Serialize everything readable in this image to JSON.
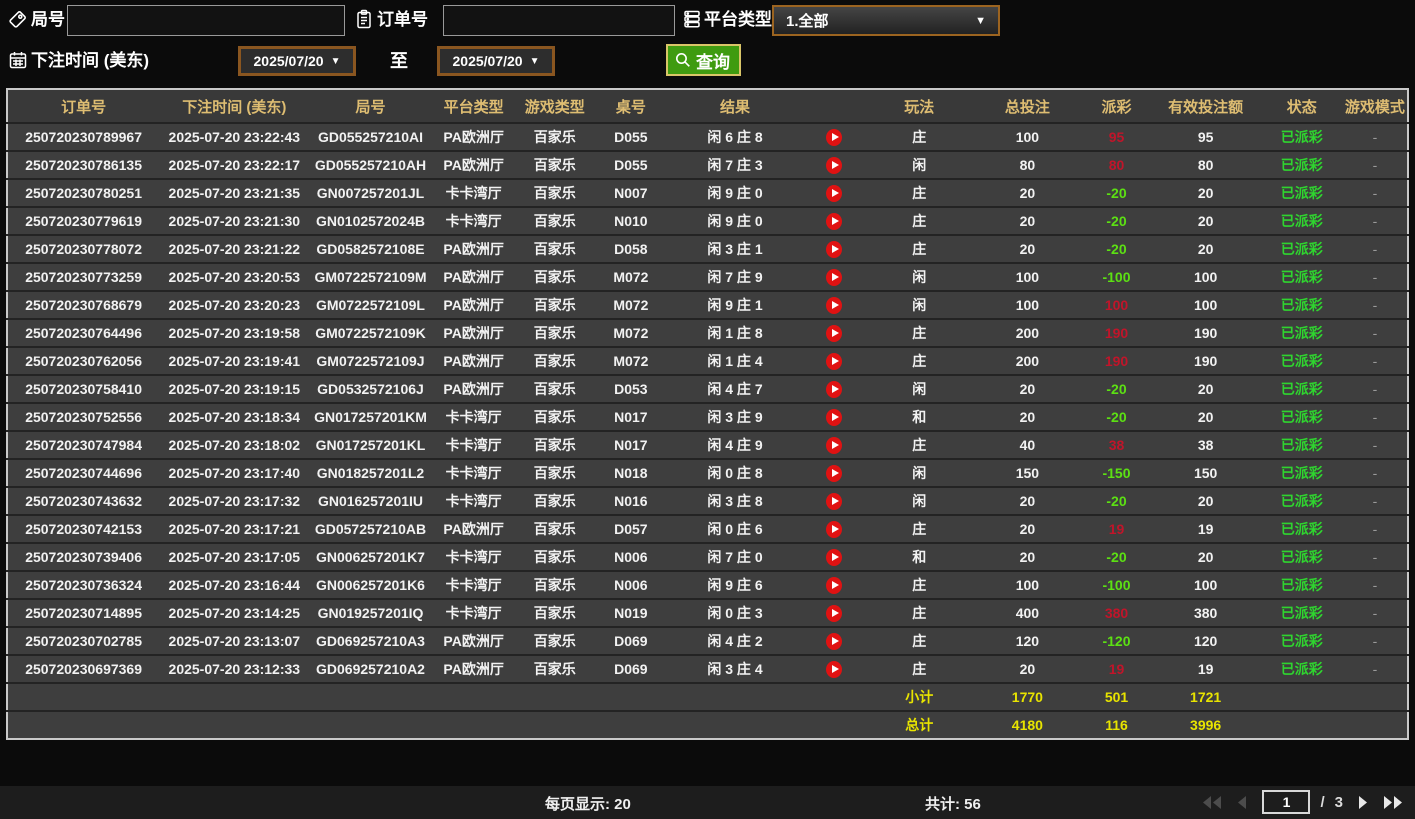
{
  "filters": {
    "game_no_label": "局号",
    "game_no_value": "",
    "order_no_label": "订单号",
    "order_no_value": "",
    "platform_label": "平台类型",
    "platform_value": "1.全部",
    "bet_time_label": "下注时间 (美东)",
    "date_from": "2025/07/20",
    "to_label": "至",
    "date_to": "2025/07/20",
    "search_label": "查询"
  },
  "table": {
    "columns": [
      "订单号",
      "下注时间 (美东)",
      "局号",
      "平台类型",
      "游戏类型",
      "桌号",
      "结果",
      "",
      "玩法",
      "总投注",
      "派彩",
      "有效投注额",
      "状态",
      "游戏模式"
    ],
    "rows": [
      {
        "order_no": "250720230789967",
        "bet_time": "2025-07-20 23:22:43",
        "round_no": "GD055257210AI",
        "platform": "PA欧洲厅",
        "game_type": "百家乐",
        "table_no": "D055",
        "result": "闲 6 庄 8",
        "bet_type": "庄",
        "total_bet": "100",
        "payout": "95",
        "payout_color": "pos",
        "valid_bet": "95",
        "status": "已派彩",
        "mode": "-"
      },
      {
        "order_no": "250720230786135",
        "bet_time": "2025-07-20 23:22:17",
        "round_no": "GD055257210AH",
        "platform": "PA欧洲厅",
        "game_type": "百家乐",
        "table_no": "D055",
        "result": "闲 7 庄 3",
        "bet_type": "闲",
        "total_bet": "80",
        "payout": "80",
        "payout_color": "pos",
        "valid_bet": "80",
        "status": "已派彩",
        "mode": "-"
      },
      {
        "order_no": "250720230780251",
        "bet_time": "2025-07-20 23:21:35",
        "round_no": "GN007257201JL",
        "platform": "卡卡湾厅",
        "game_type": "百家乐",
        "table_no": "N007",
        "result": "闲 9 庄 0",
        "bet_type": "庄",
        "total_bet": "20",
        "payout": "-20",
        "payout_color": "neg",
        "valid_bet": "20",
        "status": "已派彩",
        "mode": "-"
      },
      {
        "order_no": "250720230779619",
        "bet_time": "2025-07-20 23:21:30",
        "round_no": "GN0102572024B",
        "platform": "卡卡湾厅",
        "game_type": "百家乐",
        "table_no": "N010",
        "result": "闲 9 庄 0",
        "bet_type": "庄",
        "total_bet": "20",
        "payout": "-20",
        "payout_color": "neg",
        "valid_bet": "20",
        "status": "已派彩",
        "mode": "-"
      },
      {
        "order_no": "250720230778072",
        "bet_time": "2025-07-20 23:21:22",
        "round_no": "GD0582572108E",
        "platform": "PA欧洲厅",
        "game_type": "百家乐",
        "table_no": "D058",
        "result": "闲 3 庄 1",
        "bet_type": "庄",
        "total_bet": "20",
        "payout": "-20",
        "payout_color": "neg",
        "valid_bet": "20",
        "status": "已派彩",
        "mode": "-"
      },
      {
        "order_no": "250720230773259",
        "bet_time": "2025-07-20 23:20:53",
        "round_no": "GM0722572109M",
        "platform": "PA欧洲厅",
        "game_type": "百家乐",
        "table_no": "M072",
        "result": "闲 7 庄 9",
        "bet_type": "闲",
        "total_bet": "100",
        "payout": "-100",
        "payout_color": "neg",
        "valid_bet": "100",
        "status": "已派彩",
        "mode": "-"
      },
      {
        "order_no": "250720230768679",
        "bet_time": "2025-07-20 23:20:23",
        "round_no": "GM0722572109L",
        "platform": "PA欧洲厅",
        "game_type": "百家乐",
        "table_no": "M072",
        "result": "闲 9 庄 1",
        "bet_type": "闲",
        "total_bet": "100",
        "payout": "100",
        "payout_color": "pos",
        "valid_bet": "100",
        "status": "已派彩",
        "mode": "-"
      },
      {
        "order_no": "250720230764496",
        "bet_time": "2025-07-20 23:19:58",
        "round_no": "GM0722572109K",
        "platform": "PA欧洲厅",
        "game_type": "百家乐",
        "table_no": "M072",
        "result": "闲 1 庄 8",
        "bet_type": "庄",
        "total_bet": "200",
        "payout": "190",
        "payout_color": "pos",
        "valid_bet": "190",
        "status": "已派彩",
        "mode": "-"
      },
      {
        "order_no": "250720230762056",
        "bet_time": "2025-07-20 23:19:41",
        "round_no": "GM0722572109J",
        "platform": "PA欧洲厅",
        "game_type": "百家乐",
        "table_no": "M072",
        "result": "闲 1 庄 4",
        "bet_type": "庄",
        "total_bet": "200",
        "payout": "190",
        "payout_color": "pos",
        "valid_bet": "190",
        "status": "已派彩",
        "mode": "-"
      },
      {
        "order_no": "250720230758410",
        "bet_time": "2025-07-20 23:19:15",
        "round_no": "GD0532572106J",
        "platform": "PA欧洲厅",
        "game_type": "百家乐",
        "table_no": "D053",
        "result": "闲 4 庄 7",
        "bet_type": "闲",
        "total_bet": "20",
        "payout": "-20",
        "payout_color": "neg",
        "valid_bet": "20",
        "status": "已派彩",
        "mode": "-"
      },
      {
        "order_no": "250720230752556",
        "bet_time": "2025-07-20 23:18:34",
        "round_no": "GN017257201KM",
        "platform": "卡卡湾厅",
        "game_type": "百家乐",
        "table_no": "N017",
        "result": "闲 3 庄 9",
        "bet_type": "和",
        "total_bet": "20",
        "payout": "-20",
        "payout_color": "neg",
        "valid_bet": "20",
        "status": "已派彩",
        "mode": "-"
      },
      {
        "order_no": "250720230747984",
        "bet_time": "2025-07-20 23:18:02",
        "round_no": "GN017257201KL",
        "platform": "卡卡湾厅",
        "game_type": "百家乐",
        "table_no": "N017",
        "result": "闲 4 庄 9",
        "bet_type": "庄",
        "total_bet": "40",
        "payout": "38",
        "payout_color": "pos",
        "valid_bet": "38",
        "status": "已派彩",
        "mode": "-"
      },
      {
        "order_no": "250720230744696",
        "bet_time": "2025-07-20 23:17:40",
        "round_no": "GN018257201L2",
        "platform": "卡卡湾厅",
        "game_type": "百家乐",
        "table_no": "N018",
        "result": "闲 0 庄 8",
        "bet_type": "闲",
        "total_bet": "150",
        "payout": "-150",
        "payout_color": "neg",
        "valid_bet": "150",
        "status": "已派彩",
        "mode": "-"
      },
      {
        "order_no": "250720230743632",
        "bet_time": "2025-07-20 23:17:32",
        "round_no": "GN016257201IU",
        "platform": "卡卡湾厅",
        "game_type": "百家乐",
        "table_no": "N016",
        "result": "闲 3 庄 8",
        "bet_type": "闲",
        "total_bet": "20",
        "payout": "-20",
        "payout_color": "neg",
        "valid_bet": "20",
        "status": "已派彩",
        "mode": "-"
      },
      {
        "order_no": "250720230742153",
        "bet_time": "2025-07-20 23:17:21",
        "round_no": "GD057257210AB",
        "platform": "PA欧洲厅",
        "game_type": "百家乐",
        "table_no": "D057",
        "result": "闲 0 庄 6",
        "bet_type": "庄",
        "total_bet": "20",
        "payout": "19",
        "payout_color": "pos",
        "valid_bet": "19",
        "status": "已派彩",
        "mode": "-"
      },
      {
        "order_no": "250720230739406",
        "bet_time": "2025-07-20 23:17:05",
        "round_no": "GN006257201K7",
        "platform": "卡卡湾厅",
        "game_type": "百家乐",
        "table_no": "N006",
        "result": "闲 7 庄 0",
        "bet_type": "和",
        "total_bet": "20",
        "payout": "-20",
        "payout_color": "neg",
        "valid_bet": "20",
        "status": "已派彩",
        "mode": "-"
      },
      {
        "order_no": "250720230736324",
        "bet_time": "2025-07-20 23:16:44",
        "round_no": "GN006257201K6",
        "platform": "卡卡湾厅",
        "game_type": "百家乐",
        "table_no": "N006",
        "result": "闲 9 庄 6",
        "bet_type": "庄",
        "total_bet": "100",
        "payout": "-100",
        "payout_color": "neg",
        "valid_bet": "100",
        "status": "已派彩",
        "mode": "-"
      },
      {
        "order_no": "250720230714895",
        "bet_time": "2025-07-20 23:14:25",
        "round_no": "GN019257201IQ",
        "platform": "卡卡湾厅",
        "game_type": "百家乐",
        "table_no": "N019",
        "result": "闲 0 庄 3",
        "bet_type": "庄",
        "total_bet": "400",
        "payout": "380",
        "payout_color": "pos",
        "valid_bet": "380",
        "status": "已派彩",
        "mode": "-"
      },
      {
        "order_no": "250720230702785",
        "bet_time": "2025-07-20 23:13:07",
        "round_no": "GD069257210A3",
        "platform": "PA欧洲厅",
        "game_type": "百家乐",
        "table_no": "D069",
        "result": "闲 4 庄 2",
        "bet_type": "庄",
        "total_bet": "120",
        "payout": "-120",
        "payout_color": "neg",
        "valid_bet": "120",
        "status": "已派彩",
        "mode": "-"
      },
      {
        "order_no": "250720230697369",
        "bet_time": "2025-07-20 23:12:33",
        "round_no": "GD069257210A2",
        "platform": "PA欧洲厅",
        "game_type": "百家乐",
        "table_no": "D069",
        "result": "闲 3 庄 4",
        "bet_type": "庄",
        "total_bet": "20",
        "payout": "19",
        "payout_color": "pos",
        "valid_bet": "19",
        "status": "已派彩",
        "mode": "-"
      }
    ],
    "subtotal": {
      "label": "小计",
      "total_bet": "1770",
      "payout": "501",
      "valid_bet": "1721"
    },
    "grand_total": {
      "label": "总计",
      "total_bet": "4180",
      "payout": "116",
      "valid_bet": "3996"
    }
  },
  "footer": {
    "page_size_text": "每页显示: 20",
    "total_count_text": "共计: 56",
    "page_input": "1",
    "page_separator": "/",
    "total_pages": "3"
  },
  "colors": {
    "accent_gold_header": "#debd72",
    "positive_payout_red": "#c0152a",
    "negative_payout_green": "#5ce013",
    "status_green": "#2fd42f",
    "summary_yellow": "#e8e400",
    "search_button_green": "#3f9b10",
    "date_border_orange": "#8a5620",
    "play_icon_red": "#e01212"
  }
}
